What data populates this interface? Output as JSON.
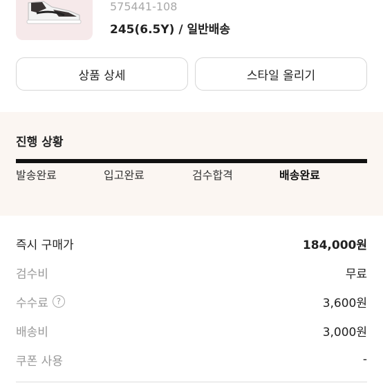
{
  "product": {
    "sku": "575441-108",
    "size_line": "245(6.5Y) / 일반배송"
  },
  "actions": {
    "detail_label": "상품 상세",
    "style_label": "스타일 올리기"
  },
  "progress": {
    "title": "진행 상황",
    "steps": [
      "발송완료",
      "입고완료",
      "검수합격",
      "배송완료"
    ],
    "active_step": "배송완료"
  },
  "pricing": {
    "buy_now": {
      "label": "즉시 구매가",
      "value": "184,000원"
    },
    "inspection": {
      "label": "검수비",
      "value": "무료"
    },
    "fee": {
      "label": "수수료",
      "value": "3,600원"
    },
    "shipping": {
      "label": "배송비",
      "value": "3,000원"
    },
    "coupon": {
      "label": "쿠폰 사용",
      "value": "-"
    }
  },
  "colors": {
    "panel_bg": "#fbf6f2",
    "thumb_bg": "#f6e9ea",
    "progress_bar": "#111111"
  }
}
